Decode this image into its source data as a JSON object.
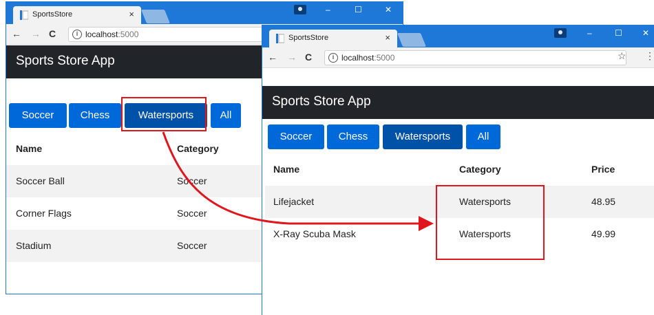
{
  "browser": {
    "tab_title": "SportsStore",
    "tab_close": "×",
    "back_glyph": "←",
    "forward_glyph": "→",
    "reload_glyph": "C",
    "info_glyph": "i",
    "url_host": "localhost",
    "url_port": ":5000",
    "star_glyph": "☆",
    "menu_glyph": "⋮",
    "minimize_glyph": "–",
    "maximize_glyph": "☐",
    "close_glyph": "✕"
  },
  "app": {
    "title": "Sports Store App"
  },
  "categories": [
    "Soccer",
    "Chess",
    "Watersports",
    "All"
  ],
  "window1": {
    "selected_category": "Watersports",
    "columns": [
      "Name",
      "Category"
    ],
    "rows": [
      [
        "Soccer Ball",
        "Soccer"
      ],
      [
        "Corner Flags",
        "Soccer"
      ],
      [
        "Stadium",
        "Soccer"
      ]
    ]
  },
  "window2": {
    "selected_category": "Watersports",
    "columns": [
      "Name",
      "Category",
      "Price"
    ],
    "rows": [
      [
        "Lifejacket",
        "Watersports",
        "48.95"
      ],
      [
        "X-Ray Scuba Mask",
        "Watersports",
        "49.99"
      ]
    ]
  },
  "colors": {
    "titlebar": "#1e78d7",
    "appbar": "#212529",
    "button": "#0069d9",
    "button_active": "#0052a8",
    "highlight": "#e0161c"
  }
}
